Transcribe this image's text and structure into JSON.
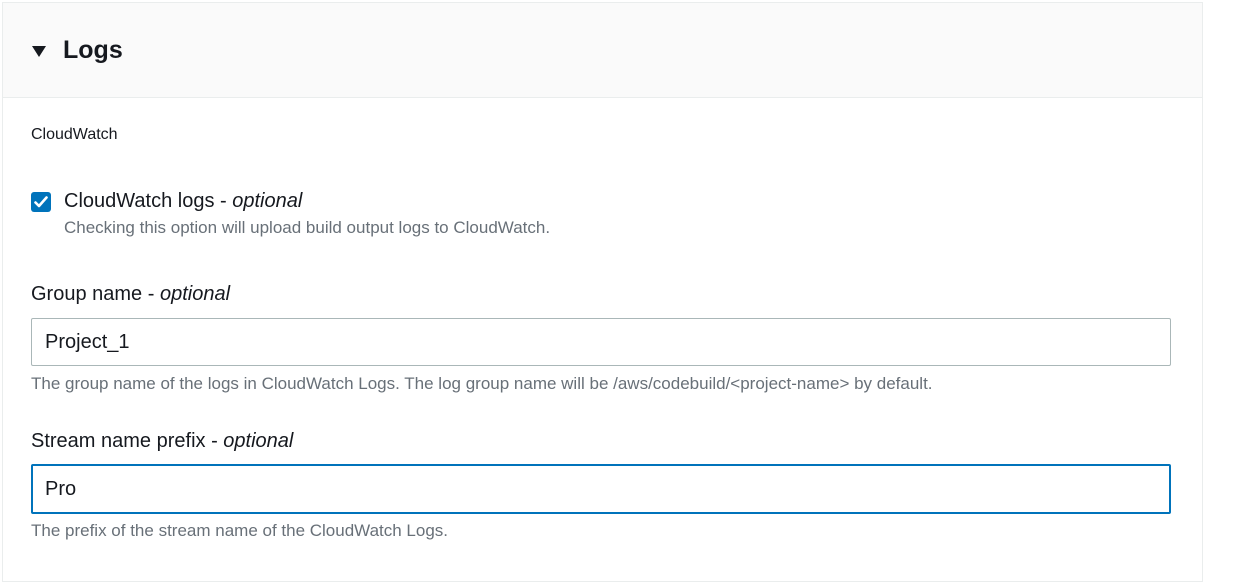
{
  "panel": {
    "title": "Logs"
  },
  "cloudwatch": {
    "section_label": "CloudWatch",
    "checkbox": {
      "label": "CloudWatch logs",
      "separator": " - ",
      "optional": "optional",
      "checked": true,
      "description": "Checking this option will upload build output logs to CloudWatch."
    }
  },
  "group_name": {
    "label": "Group name",
    "separator": " - ",
    "optional": "optional",
    "value": "Project_1",
    "description": "The group name of the logs in CloudWatch Logs. The log group name will be /aws/codebuild/<project-name> by default."
  },
  "stream_prefix": {
    "label": "Stream name prefix",
    "separator": " - ",
    "optional": "optional",
    "value": "Pro",
    "focused": true,
    "description": "The prefix of the stream name of the CloudWatch Logs."
  },
  "colors": {
    "accent": "#0073bb",
    "text": "#16191f",
    "secondary_text": "#687078",
    "border": "#aab7b8",
    "header_bg": "#fafafa"
  },
  "icons": {
    "expand": "caret-down-icon",
    "checkbox": "checkmark-icon"
  }
}
